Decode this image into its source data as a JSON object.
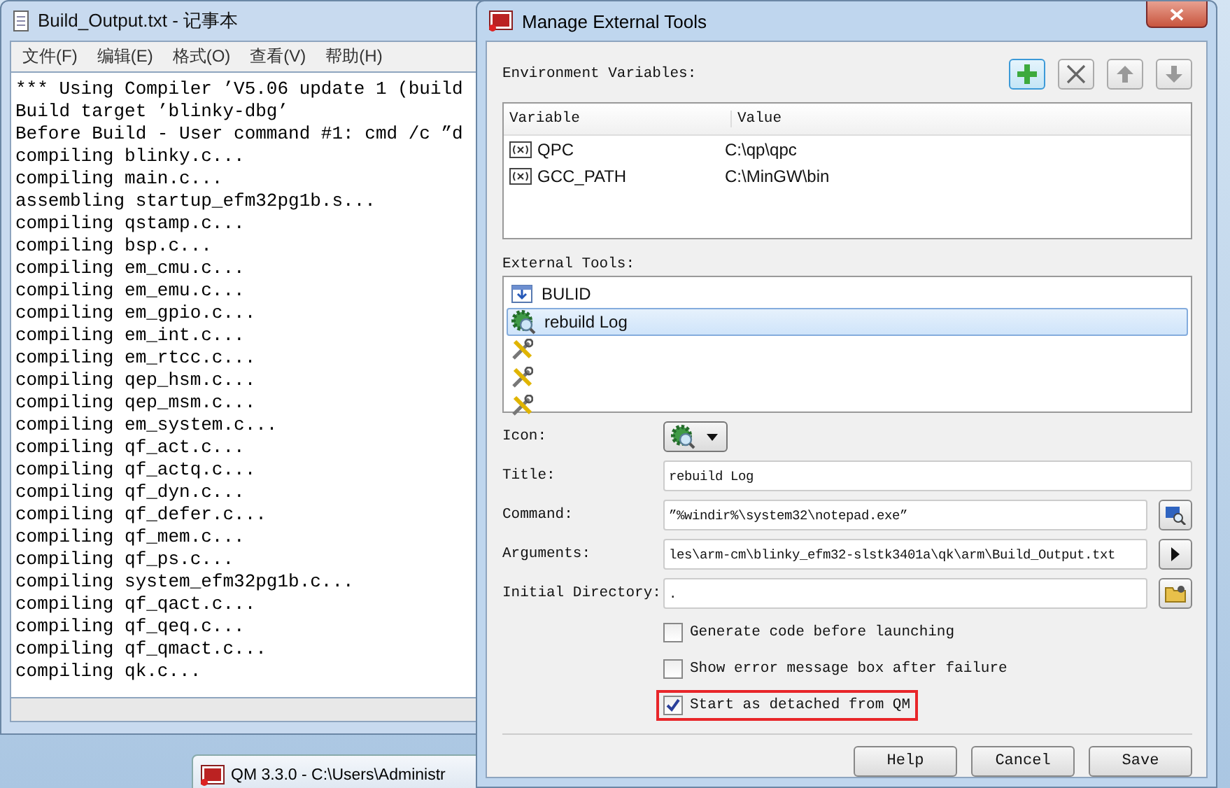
{
  "notepad": {
    "title": "Build_Output.txt - 记事本",
    "menu": [
      "文件(F)",
      "编辑(E)",
      "格式(O)",
      "查看(V)",
      "帮助(H)"
    ],
    "lines": [
      "*** Using Compiler ’V5.06 update 1 (build",
      "Build target ’blinky-dbg’",
      "Before Build - User command #1: cmd /c ”d",
      "compiling blinky.c...",
      "compiling main.c...",
      "assembling startup_efm32pg1b.s...",
      "compiling qstamp.c...",
      "compiling bsp.c...",
      "compiling em_cmu.c...",
      "compiling em_emu.c...",
      "compiling em_gpio.c...",
      "compiling em_int.c...",
      "compiling em_rtcc.c...",
      "compiling qep_hsm.c...",
      "compiling qep_msm.c...",
      "compiling em_system.c...",
      "compiling qf_act.c...",
      "compiling qf_actq.c...",
      "compiling qf_dyn.c...",
      "compiling qf_defer.c...",
      "compiling qf_mem.c...",
      "compiling qf_ps.c...",
      "compiling system_efm32pg1b.c...",
      "compiling qf_qact.c...",
      "compiling qf_qeq.c...",
      "compiling qf_qmact.c...",
      "compiling qk.c..."
    ]
  },
  "taskbar": {
    "label": "QM 3.3.0 - C:\\Users\\Administr"
  },
  "dialog": {
    "title": "Manage External Tools",
    "env_label": "Environment Variables:",
    "env_table": {
      "columns": [
        "Variable",
        "Value"
      ],
      "rows": [
        {
          "variable": "QPC",
          "value": "C:\\qp\\qpc"
        },
        {
          "variable": "GCC_PATH",
          "value": "C:\\MinGW\\bin"
        }
      ]
    },
    "tools_label": "External Tools:",
    "tools": [
      {
        "kind": "build",
        "label": "BULID",
        "selected": false
      },
      {
        "kind": "gear",
        "label": "rebuild Log",
        "selected": true
      },
      {
        "kind": "tools",
        "selected": false
      },
      {
        "kind": "tools",
        "selected": false
      },
      {
        "kind": "tools",
        "selected": false
      }
    ],
    "fields": [
      {
        "kind": "icon",
        "label": "Icon:"
      },
      {
        "kind": "text",
        "label": "Title:",
        "value": "rebuild Log"
      },
      {
        "kind": "browse",
        "label": "Command:",
        "value": "”%windir%\\system32\\notepad.exe”"
      },
      {
        "kind": "arrow",
        "label": "Arguments:",
        "value": "les\\arm-cm\\blinky_efm32-slstk3401a\\qk\\arm\\Build_Output.txt"
      },
      {
        "kind": "folder",
        "label": "Initial Directory:",
        "value": "."
      }
    ],
    "checkboxes": [
      {
        "label": "Generate code before launching",
        "checked": false,
        "annotated": false
      },
      {
        "label": "Show error message box after failure",
        "checked": false,
        "annotated": false
      },
      {
        "label": "Start as detached from QM",
        "checked": true,
        "annotated": true
      }
    ],
    "buttons": [
      "Help",
      "Cancel",
      "Save"
    ]
  }
}
